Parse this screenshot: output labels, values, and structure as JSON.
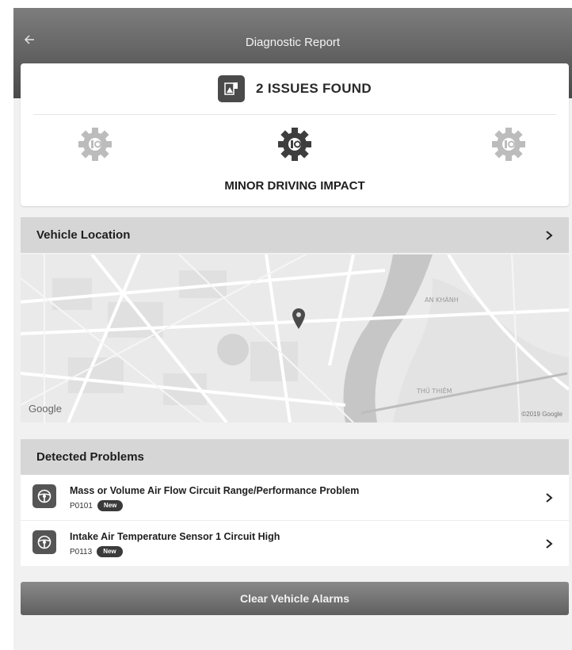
{
  "header": {
    "title": "Diagnostic Report",
    "back_icon": "arrow-left-icon"
  },
  "summary": {
    "issues_label": "2 ISSUES FOUND",
    "issues_icon": "warning-document-icon",
    "impact_label": "MINOR DRIVING IMPACT",
    "impact_icon": "gear-icon"
  },
  "location": {
    "title": "Vehicle Location",
    "map_logo": "Google",
    "map_copyright": "©2019 Google",
    "map_labels": [
      "AN KHÁNH",
      "THỦ THIÊM"
    ],
    "pin_icon": "map-pin-icon"
  },
  "problems": {
    "title": "Detected Problems",
    "items": [
      {
        "name": "Mass or Volume Air Flow Circuit Range/Performance Problem",
        "code": "P0101",
        "badge": "New",
        "icon": "steering-wheel-icon"
      },
      {
        "name": "Intake Air Temperature Sensor 1 Circuit High",
        "code": "P0113",
        "badge": "New",
        "icon": "steering-wheel-icon"
      }
    ]
  },
  "actions": {
    "clear_label": "Clear Vehicle Alarms"
  },
  "colors": {
    "header": "#5a5a5a",
    "section_bar": "#d6d6d6",
    "button": "#6e6e6e",
    "badge": "#3a3a3a"
  }
}
